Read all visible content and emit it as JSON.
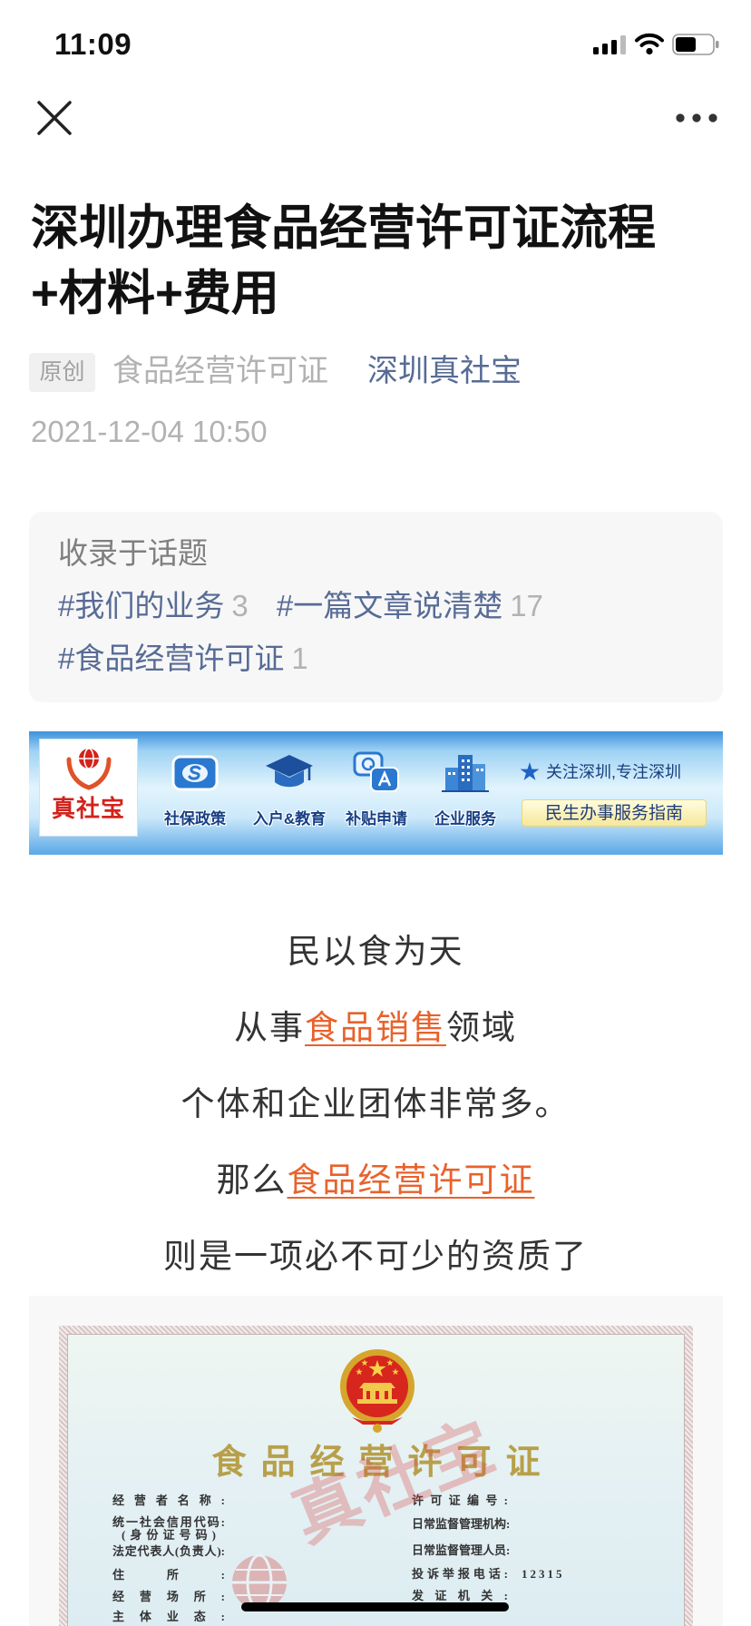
{
  "status_bar": {
    "time": "11:09",
    "icons": [
      "signal-icon",
      "wifi-icon",
      "battery-icon"
    ]
  },
  "nav": {
    "left_icon": "close-icon",
    "right_icon": "more-icon"
  },
  "article": {
    "title_lines": [
      "深圳办理食品经营许可证流程",
      "+材料+费用"
    ],
    "original_tag": "原创",
    "category": "食品经营许可证",
    "account": "深圳真社宝",
    "date": "2021-12-04 10:50"
  },
  "topics": {
    "heading": "收录于话题",
    "items": [
      {
        "tag": "#我们的业务",
        "count": "3"
      },
      {
        "tag": "#一篇文章说清楚",
        "count": "17"
      },
      {
        "tag": "#食品经营许可证",
        "count": "1"
      }
    ]
  },
  "banner": {
    "logo_text": "真社宝",
    "logo_icon": "globe-hands-logo",
    "items": [
      {
        "label": "社保政策",
        "icon": "social-security-card-icon"
      },
      {
        "label": "入户&教育",
        "icon": "graduation-cap-icon"
      },
      {
        "label": "补贴申请",
        "icon": "qa-bubbles-icon"
      },
      {
        "label": "企业服务",
        "icon": "buildings-icon"
      }
    ],
    "slogan_icon": "star-icon",
    "slogan": "关注深圳,专注深圳",
    "guide": "民生办事服务指南"
  },
  "body": {
    "line1": "民以食为天",
    "line2_pre": "从事",
    "line2_link": "食品销售",
    "line2_post": "领域",
    "line3": "个体和企业团体非常多。",
    "line4_pre": "那么",
    "line4_link": "食品经营许可证",
    "line5": "则是一项必不可少的资质了"
  },
  "certificate": {
    "emblem": "national-emblem",
    "title": "食品经营许可证",
    "left_fields": [
      "经营者名称:",
      "统一社会信用代码:",
      "(身份证号码)",
      "法定代表人(负责人):",
      "住所:",
      "经营场所:",
      "主体业态:"
    ],
    "right_fields": [
      "许可证编号:",
      "日常监督管理机构:",
      "日常监督管理人员:",
      "投诉举报电话:",
      "发证机关:"
    ],
    "complaint_phone": "12315",
    "watermark": "真社宝"
  },
  "colors": {
    "link_blue": "#576b95",
    "link_orange": "#e8622c",
    "meta_gray": "#b2b2b2",
    "topic_bg": "#f7f7f7",
    "banner_blue": "#3d92dd",
    "brand_red": "#d2231c",
    "cert_gold": "#b8a04a"
  }
}
